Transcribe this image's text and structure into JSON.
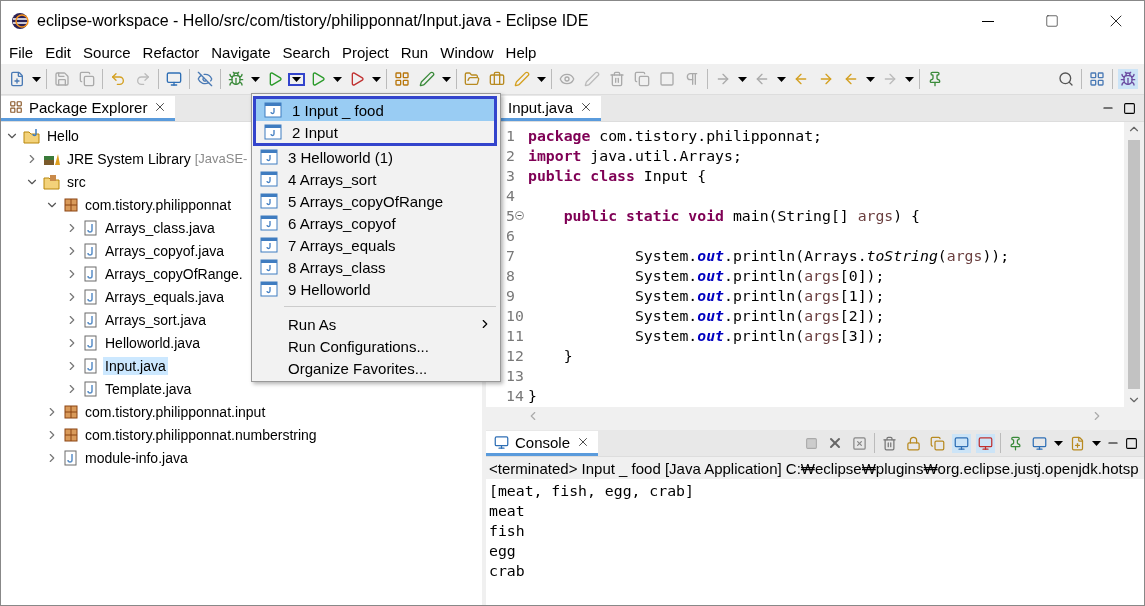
{
  "window": {
    "title": "eclipse-workspace - Hello/src/com/tistory/philipponnat/Input.java - Eclipse IDE"
  },
  "menu_bar": [
    "File",
    "Edit",
    "Source",
    "Refactor",
    "Navigate",
    "Search",
    "Project",
    "Run",
    "Window",
    "Help"
  ],
  "package_explorer": {
    "tab": {
      "label": "Package Explorer",
      "selected": true
    },
    "tree": [
      {
        "kind": "project",
        "label": "Hello",
        "expanded": true,
        "selected": false,
        "children": [
          {
            "kind": "library",
            "label": "JRE System Library",
            "decoration": "[JavaSE-",
            "expanded": false,
            "selected": false
          },
          {
            "kind": "folder",
            "label": "src",
            "expanded": true,
            "selected": false,
            "children": [
              {
                "kind": "package",
                "label": "com.tistory.philipponnat",
                "expanded": true,
                "selected": false,
                "children": [
                  {
                    "kind": "file",
                    "label": "Arrays_class.java",
                    "expanded": false,
                    "selected": false
                  },
                  {
                    "kind": "file",
                    "label": "Arrays_copyof.java",
                    "expanded": false,
                    "selected": false
                  },
                  {
                    "kind": "file",
                    "label": "Arrays_copyOfRange.",
                    "expanded": false,
                    "selected": false
                  },
                  {
                    "kind": "file",
                    "label": "Arrays_equals.java",
                    "expanded": false,
                    "selected": false
                  },
                  {
                    "kind": "file",
                    "label": "Arrays_sort.java",
                    "expanded": false,
                    "selected": false
                  },
                  {
                    "kind": "file",
                    "label": "Helloworld.java",
                    "expanded": false,
                    "selected": false
                  },
                  {
                    "kind": "file",
                    "label": "Input.java",
                    "expanded": false,
                    "selected": true
                  },
                  {
                    "kind": "file",
                    "label": "Template.java",
                    "expanded": false,
                    "selected": false
                  }
                ]
              },
              {
                "kind": "package",
                "label": "com.tistory.philipponnat.input",
                "expanded": false,
                "selected": false
              },
              {
                "kind": "package",
                "label": "com.tistory.philipponnat.numberstring",
                "expanded": false,
                "selected": false
              },
              {
                "kind": "file",
                "label": "module-info.java",
                "expanded": false,
                "selected": false
              }
            ]
          }
        ]
      }
    ]
  },
  "run_menu": {
    "items": [
      {
        "kind": "launch",
        "label": "1 Input _ food",
        "selected": true
      },
      {
        "kind": "launch",
        "label": "2 Input",
        "selected": false
      },
      {
        "kind": "launch",
        "label": "3 Helloworld (1)",
        "selected": false
      },
      {
        "kind": "launch",
        "label": "4 Arrays_sort",
        "selected": false
      },
      {
        "kind": "launch",
        "label": "5 Arrays_copyOfRange",
        "selected": false
      },
      {
        "kind": "launch",
        "label": "6 Arrays_copyof",
        "selected": false
      },
      {
        "kind": "launch",
        "label": "7 Arrays_equals",
        "selected": false
      },
      {
        "kind": "launch",
        "label": "8 Arrays_class",
        "selected": false
      },
      {
        "kind": "launch",
        "label": "9 Helloworld",
        "selected": false
      },
      {
        "kind": "submenu",
        "label": "Run As",
        "selected": false
      },
      {
        "kind": "action",
        "label": "Run Configurations...",
        "selected": false
      },
      {
        "kind": "action",
        "label": "Organize Favorites...",
        "selected": false
      }
    ]
  },
  "editor": {
    "tab": {
      "label": "Input.java",
      "selected": true
    },
    "lines": [
      {
        "number": "1",
        "fold": false,
        "tokens": [
          {
            "kind": "keyword",
            "text": "package"
          },
          {
            "kind": "plain",
            "text": " com.tistory.philipponnat;"
          }
        ]
      },
      {
        "number": "2",
        "fold": false,
        "tokens": [
          {
            "kind": "keyword",
            "text": "import"
          },
          {
            "kind": "plain",
            "text": " java.util.Arrays;"
          }
        ]
      },
      {
        "number": "3",
        "fold": false,
        "tokens": [
          {
            "kind": "keyword",
            "text": "public class"
          },
          {
            "kind": "plain",
            "text": " Input {"
          }
        ]
      },
      {
        "number": "4",
        "fold": false
      },
      {
        "number": "5",
        "fold": true,
        "tokens": [
          {
            "kind": "keyword",
            "text": "    public static void"
          },
          {
            "kind": "plain",
            "text": " main(String[] "
          },
          {
            "kind": "param",
            "text": "args"
          },
          {
            "kind": "plain",
            "text": ") {"
          }
        ]
      },
      {
        "number": "6",
        "fold": false
      },
      {
        "number": "7",
        "fold": false,
        "tokens": [
          {
            "kind": "plain",
            "text": "            System."
          },
          {
            "kind": "field",
            "text": "out"
          },
          {
            "kind": "plain",
            "text": ".println(Arrays."
          },
          {
            "kind": "static",
            "text": "toString"
          },
          {
            "kind": "plain",
            "text": "("
          },
          {
            "kind": "param",
            "text": "args"
          },
          {
            "kind": "plain",
            "text": "));"
          }
        ]
      },
      {
        "number": "8",
        "fold": false,
        "tokens": [
          {
            "kind": "plain",
            "text": "            System."
          },
          {
            "kind": "field",
            "text": "out"
          },
          {
            "kind": "plain",
            "text": ".println("
          },
          {
            "kind": "param",
            "text": "args"
          },
          {
            "kind": "plain",
            "text": "[0]);"
          }
        ]
      },
      {
        "number": "9",
        "fold": false,
        "tokens": [
          {
            "kind": "plain",
            "text": "            System."
          },
          {
            "kind": "field",
            "text": "out"
          },
          {
            "kind": "plain",
            "text": ".println("
          },
          {
            "kind": "param",
            "text": "args"
          },
          {
            "kind": "plain",
            "text": "[1]);"
          }
        ]
      },
      {
        "number": "10",
        "fold": false,
        "tokens": [
          {
            "kind": "plain",
            "text": "            System."
          },
          {
            "kind": "field",
            "text": "out"
          },
          {
            "kind": "plain",
            "text": ".println("
          },
          {
            "kind": "param",
            "text": "args"
          },
          {
            "kind": "plain",
            "text": "[2]);"
          }
        ]
      },
      {
        "number": "11",
        "fold": false,
        "tokens": [
          {
            "kind": "plain",
            "text": "            System."
          },
          {
            "kind": "field",
            "text": "out"
          },
          {
            "kind": "plain",
            "text": ".println("
          },
          {
            "kind": "param",
            "text": "args"
          },
          {
            "kind": "plain",
            "text": "[3]);"
          }
        ]
      },
      {
        "number": "12",
        "fold": false,
        "tokens": [
          {
            "kind": "plain",
            "text": "    }"
          }
        ]
      },
      {
        "number": "13",
        "fold": false
      },
      {
        "number": "14",
        "fold": false,
        "tokens": [
          {
            "kind": "plain",
            "text": "}"
          }
        ]
      }
    ]
  },
  "console": {
    "tab": {
      "label": "Console",
      "selected": true
    },
    "status": "<terminated> Input _ food [Java Application] C:₩eclipse₩plugins₩org.eclipse.justj.openjdk.hotsp",
    "output": [
      "[meat, fish, egg, crab]",
      "meat",
      "fish",
      "egg",
      "crab"
    ]
  }
}
